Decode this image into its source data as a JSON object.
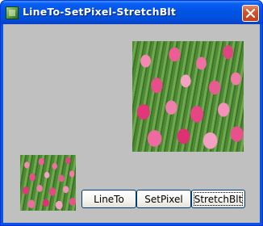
{
  "window": {
    "title": "LineTo-SetPixel-StretchBlt",
    "icon": "app-icon",
    "close_icon": "close-icon"
  },
  "canvas": {
    "large_image": "tulip-field-image",
    "small_image": "tulip-field-image"
  },
  "buttons": {
    "lineto": "LineTo",
    "setpixel": "SetPixel",
    "stretchblt": "StretchBlt"
  },
  "colors": {
    "titlebar": "#0054e3",
    "client_background": "#c0c0c0",
    "close_button": "#d4532a"
  }
}
